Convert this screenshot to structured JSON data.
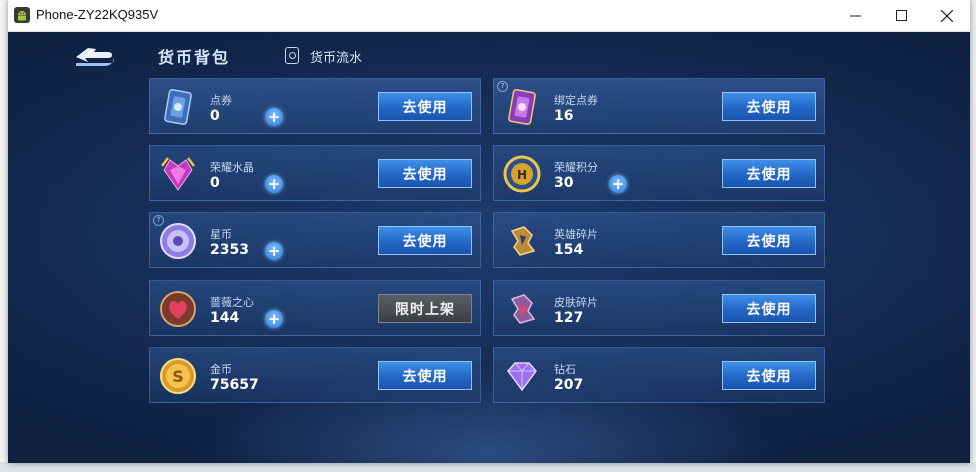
{
  "window": {
    "title": "Phone-ZY22KQ935V"
  },
  "header": {
    "title": "货币背包",
    "flow_label": "货币流水"
  },
  "left_items": [
    {
      "name": "点券",
      "value": "0",
      "button": "去使用",
      "plus": true,
      "icon": "coupon-card-icon"
    },
    {
      "name": "荣耀水晶",
      "value": "0",
      "button": "去使用",
      "plus": true,
      "icon": "glory-crystal-icon"
    },
    {
      "name": "星币",
      "value": "2353",
      "button": "去使用",
      "plus": true,
      "icon": "star-coin-icon"
    },
    {
      "name": "蔷薇之心",
      "value": "144",
      "button": "限时上架",
      "plus": true,
      "icon": "rose-heart-icon"
    },
    {
      "name": "金币",
      "value": "75657",
      "button": "去使用",
      "plus": false,
      "icon": "gold-coin-icon"
    }
  ],
  "right_items": [
    {
      "name": "绑定点券",
      "value": "16",
      "button": "去使用",
      "plus": false,
      "icon": "bound-coupon-icon"
    },
    {
      "name": "荣耀积分",
      "value": "30",
      "button": "去使用",
      "plus": true,
      "icon": "glory-points-icon"
    },
    {
      "name": "英雄碎片",
      "value": "154",
      "button": "去使用",
      "plus": false,
      "icon": "hero-fragment-icon"
    },
    {
      "name": "皮肤碎片",
      "value": "127",
      "button": "去使用",
      "plus": false,
      "icon": "skin-fragment-icon"
    },
    {
      "name": "钻石",
      "value": "207",
      "button": "去使用",
      "plus": false,
      "icon": "diamond-icon"
    }
  ],
  "colors": {
    "use_button": "#2a6fd0",
    "limited_button": "#44484f",
    "background": "#152c55"
  }
}
